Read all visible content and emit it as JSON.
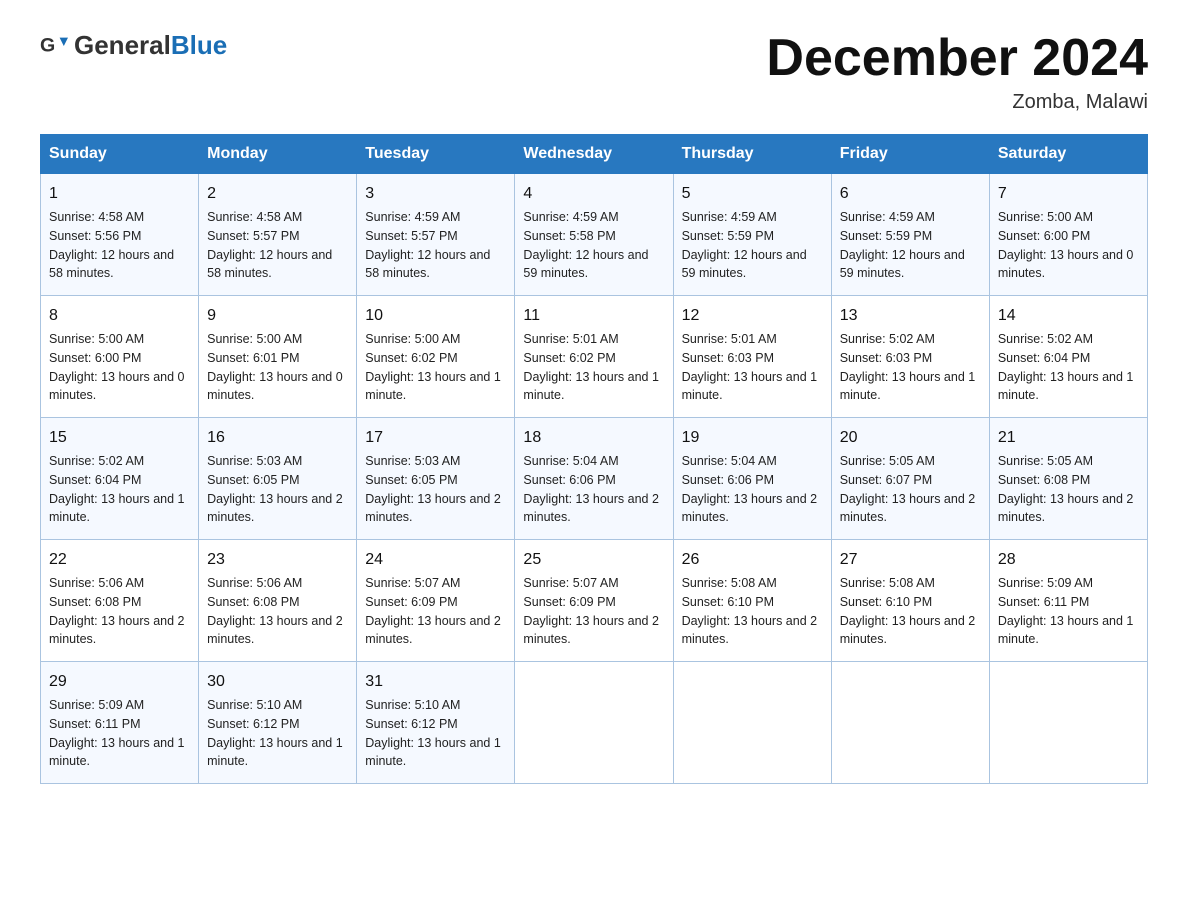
{
  "header": {
    "logo_general": "General",
    "logo_blue": "Blue",
    "title": "December 2024",
    "location": "Zomba, Malawi"
  },
  "weekdays": [
    "Sunday",
    "Monday",
    "Tuesday",
    "Wednesday",
    "Thursday",
    "Friday",
    "Saturday"
  ],
  "weeks": [
    [
      {
        "day": 1,
        "sunrise": "4:58 AM",
        "sunset": "5:56 PM",
        "daylight": "12 hours and 58 minutes."
      },
      {
        "day": 2,
        "sunrise": "4:58 AM",
        "sunset": "5:57 PM",
        "daylight": "12 hours and 58 minutes."
      },
      {
        "day": 3,
        "sunrise": "4:59 AM",
        "sunset": "5:57 PM",
        "daylight": "12 hours and 58 minutes."
      },
      {
        "day": 4,
        "sunrise": "4:59 AM",
        "sunset": "5:58 PM",
        "daylight": "12 hours and 59 minutes."
      },
      {
        "day": 5,
        "sunrise": "4:59 AM",
        "sunset": "5:59 PM",
        "daylight": "12 hours and 59 minutes."
      },
      {
        "day": 6,
        "sunrise": "4:59 AM",
        "sunset": "5:59 PM",
        "daylight": "12 hours and 59 minutes."
      },
      {
        "day": 7,
        "sunrise": "5:00 AM",
        "sunset": "6:00 PM",
        "daylight": "13 hours and 0 minutes."
      }
    ],
    [
      {
        "day": 8,
        "sunrise": "5:00 AM",
        "sunset": "6:00 PM",
        "daylight": "13 hours and 0 minutes."
      },
      {
        "day": 9,
        "sunrise": "5:00 AM",
        "sunset": "6:01 PM",
        "daylight": "13 hours and 0 minutes."
      },
      {
        "day": 10,
        "sunrise": "5:00 AM",
        "sunset": "6:02 PM",
        "daylight": "13 hours and 1 minute."
      },
      {
        "day": 11,
        "sunrise": "5:01 AM",
        "sunset": "6:02 PM",
        "daylight": "13 hours and 1 minute."
      },
      {
        "day": 12,
        "sunrise": "5:01 AM",
        "sunset": "6:03 PM",
        "daylight": "13 hours and 1 minute."
      },
      {
        "day": 13,
        "sunrise": "5:02 AM",
        "sunset": "6:03 PM",
        "daylight": "13 hours and 1 minute."
      },
      {
        "day": 14,
        "sunrise": "5:02 AM",
        "sunset": "6:04 PM",
        "daylight": "13 hours and 1 minute."
      }
    ],
    [
      {
        "day": 15,
        "sunrise": "5:02 AM",
        "sunset": "6:04 PM",
        "daylight": "13 hours and 1 minute."
      },
      {
        "day": 16,
        "sunrise": "5:03 AM",
        "sunset": "6:05 PM",
        "daylight": "13 hours and 2 minutes."
      },
      {
        "day": 17,
        "sunrise": "5:03 AM",
        "sunset": "6:05 PM",
        "daylight": "13 hours and 2 minutes."
      },
      {
        "day": 18,
        "sunrise": "5:04 AM",
        "sunset": "6:06 PM",
        "daylight": "13 hours and 2 minutes."
      },
      {
        "day": 19,
        "sunrise": "5:04 AM",
        "sunset": "6:06 PM",
        "daylight": "13 hours and 2 minutes."
      },
      {
        "day": 20,
        "sunrise": "5:05 AM",
        "sunset": "6:07 PM",
        "daylight": "13 hours and 2 minutes."
      },
      {
        "day": 21,
        "sunrise": "5:05 AM",
        "sunset": "6:08 PM",
        "daylight": "13 hours and 2 minutes."
      }
    ],
    [
      {
        "day": 22,
        "sunrise": "5:06 AM",
        "sunset": "6:08 PM",
        "daylight": "13 hours and 2 minutes."
      },
      {
        "day": 23,
        "sunrise": "5:06 AM",
        "sunset": "6:08 PM",
        "daylight": "13 hours and 2 minutes."
      },
      {
        "day": 24,
        "sunrise": "5:07 AM",
        "sunset": "6:09 PM",
        "daylight": "13 hours and 2 minutes."
      },
      {
        "day": 25,
        "sunrise": "5:07 AM",
        "sunset": "6:09 PM",
        "daylight": "13 hours and 2 minutes."
      },
      {
        "day": 26,
        "sunrise": "5:08 AM",
        "sunset": "6:10 PM",
        "daylight": "13 hours and 2 minutes."
      },
      {
        "day": 27,
        "sunrise": "5:08 AM",
        "sunset": "6:10 PM",
        "daylight": "13 hours and 2 minutes."
      },
      {
        "day": 28,
        "sunrise": "5:09 AM",
        "sunset": "6:11 PM",
        "daylight": "13 hours and 1 minute."
      }
    ],
    [
      {
        "day": 29,
        "sunrise": "5:09 AM",
        "sunset": "6:11 PM",
        "daylight": "13 hours and 1 minute."
      },
      {
        "day": 30,
        "sunrise": "5:10 AM",
        "sunset": "6:12 PM",
        "daylight": "13 hours and 1 minute."
      },
      {
        "day": 31,
        "sunrise": "5:10 AM",
        "sunset": "6:12 PM",
        "daylight": "13 hours and 1 minute."
      },
      null,
      null,
      null,
      null
    ]
  ],
  "labels": {
    "sunrise": "Sunrise:",
    "sunset": "Sunset:",
    "daylight": "Daylight:"
  }
}
